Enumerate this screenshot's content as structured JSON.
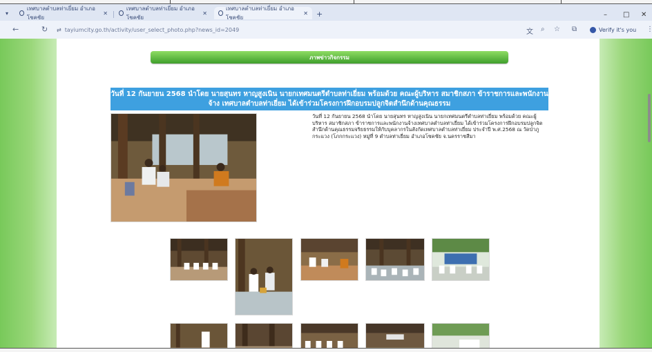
{
  "browser": {
    "tabs": [
      {
        "label": "เทศบาลตำบลท่าเยี่ยม อำเภอโชคชัย",
        "active": false
      },
      {
        "label": "เทศบาลตำบลท่าเยี่ยม อำเภอโชคชัย",
        "active": false
      },
      {
        "label": "เทศบาลตำบลท่าเยี่ยม อำเภอโชคชัย",
        "active": true
      }
    ],
    "new_tab": "+",
    "url": "tayiumcity.go.th/activity/user_select_photo.php?news_id=2049",
    "profile_label": "Verify it's you"
  },
  "page": {
    "activity_button": "ภาพข่าวกิจกรรม",
    "headline": "วันที่ 12 กันยายน 2568 นำโดย นายสุนทร หาญสูงเนิน นายกเทศมนตรีตำบลท่าเยี่ยม พร้อมด้วย คณะผู้บริหาร สมาชิกสภา ข้าราชการและพนักงานจ้าง เทศบาลตำบลท่าเยี่ยม ได้เข้าร่วมโครงการฝึกอบรมปลูกจิตสำนึกด้านคุณธรรม",
    "body": "วันที่ 12 กันยายน 2568 นำโดย นายสุนทร หาญสูงเนิน นายกเทศมนตรีตำบลท่าเยี่ยม พร้อมด้วย คณะผู้บริหาร สมาชิกสภา ข้าราชการและพนักงานจ้างเทศบาลตำบลท่าเยี่ยม ได้เข้าร่วมโครงการฝึกอบรมปลูกจิตสำนึกด้านคุณธรรมจริยธรรมให้กับบุคลากรในสังกัดเทศบาลตำบลท่าเยี่ยม ประจำปี พ.ศ.2568 ณ วัดป่าภูกระแวง (โภกกระแวง) หมู่ที่ 9 ตำบลท่าเยี่ยม อำเภอโชคชัย จ.นครราชสีมา"
  },
  "colors": {
    "sidebar_green": "#78c95a",
    "button_green": "#3f9f2c",
    "headline_blue": "#3ea0e0"
  }
}
